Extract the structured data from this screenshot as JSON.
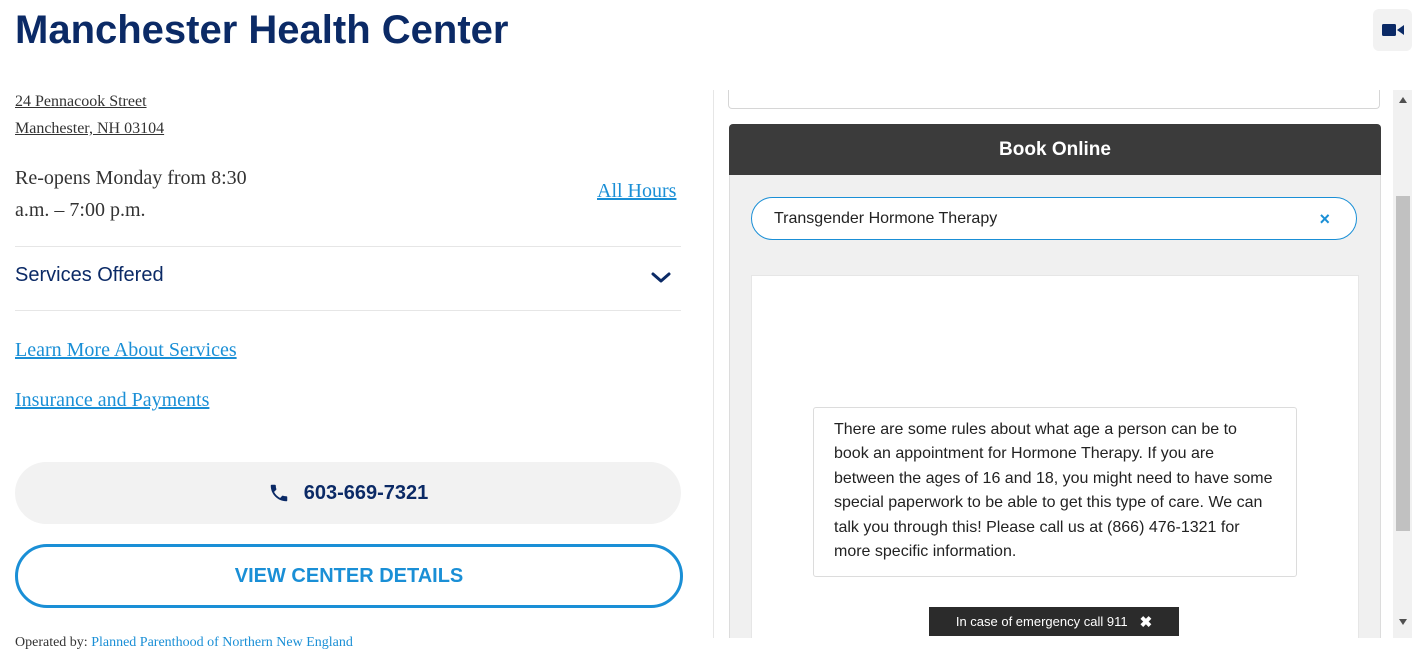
{
  "header": {
    "title": "Manchester Health Center",
    "video_icon": "video-camera-icon"
  },
  "address": {
    "line1": "24 Pennacook Street",
    "line2": "Manchester, NH 03104"
  },
  "hours": {
    "status": "Re-opens Monday from 8:30 a.m. – 7:00 p.m.",
    "all_hours_link": "All Hours"
  },
  "services": {
    "label": "Services Offered",
    "icon": "chevron-down-icon"
  },
  "links": {
    "learn_more": "Learn More About Services",
    "insurance": "Insurance and Payments"
  },
  "phone": {
    "number": "603-669-7321",
    "icon": "phone-icon"
  },
  "details_button": "VIEW CENTER DETAILS",
  "operated_by": {
    "label": "Operated by:",
    "org": "Planned Parenthood of Northern New England"
  },
  "booking": {
    "header": "Book Online",
    "selected_service": "Transgender Hormone Therapy",
    "clear_icon": "×",
    "message": "There are some rules about what age a person can be to book an appointment for Hormone Therapy. If you are between the ages of 16 and 18, you might need to have some special paperwork to be able to get this type of care. We can talk you through this! Please call us at (866) 476-1321 for more specific information."
  },
  "emergency": {
    "text": "In case of emergency call 911",
    "close": "✖"
  },
  "colors": {
    "navy": "#0b2a66",
    "link_blue": "#1a8fd6",
    "dark_header": "#3b3b3b"
  }
}
